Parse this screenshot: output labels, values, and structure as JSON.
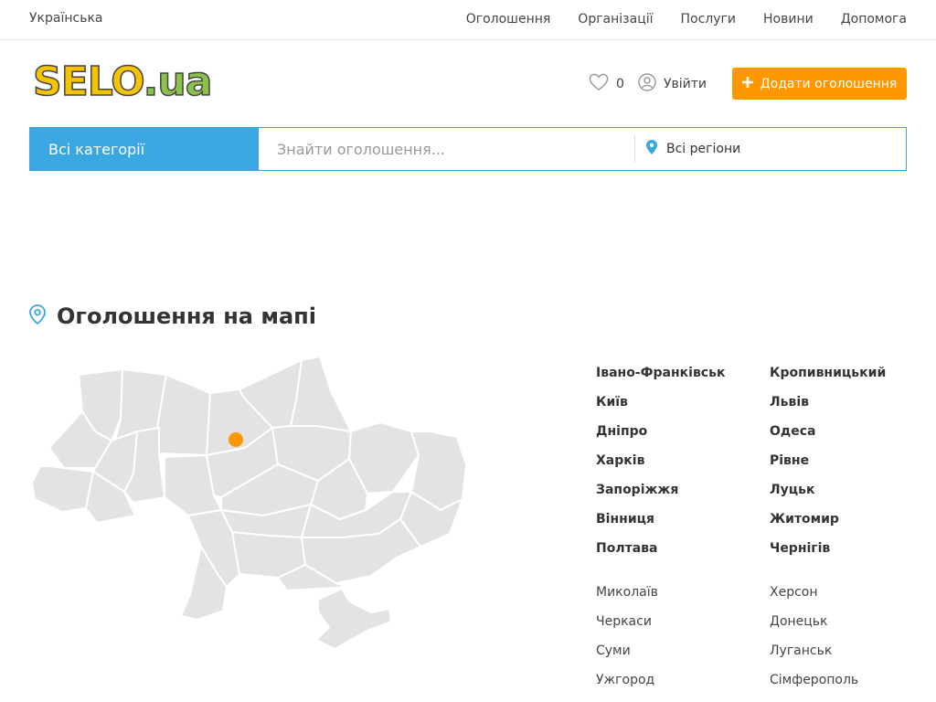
{
  "topbar": {
    "language": "Українська",
    "nav": [
      "Оголошення",
      "Організації",
      "Послуги",
      "Новини",
      "Допомога"
    ]
  },
  "header": {
    "logo_part1": "SELO",
    "logo_part2": ".ua",
    "favorites_count": "0",
    "login_label": "Увійти",
    "add_button_label": "Додати оголошення",
    "accent_color": "#ff9800"
  },
  "search": {
    "category_label": "Всі категорії",
    "placeholder": "Знайти оголошення...",
    "region_label": "Всі регіони",
    "category_color": "#3ba7e0"
  },
  "map_section": {
    "title": "Оголошення на мапі",
    "marker_color": "#ff9800",
    "region_fill": "#e3e3e3"
  },
  "cities": {
    "major": [
      "Івано-Франківськ",
      "Кропивницький",
      "Київ",
      "Львів",
      "Дніпро",
      "Одеса",
      "Харків",
      "Рівне",
      "Запоріжжя",
      "Луцьк",
      "Вінниця",
      "Житомир",
      "Полтава",
      "Чернігів"
    ],
    "minor": [
      "Миколаїв",
      "Херсон",
      "Черкаси",
      "Донецьк",
      "Суми",
      "Луганськ",
      "Ужгород",
      "Сімферополь"
    ]
  }
}
